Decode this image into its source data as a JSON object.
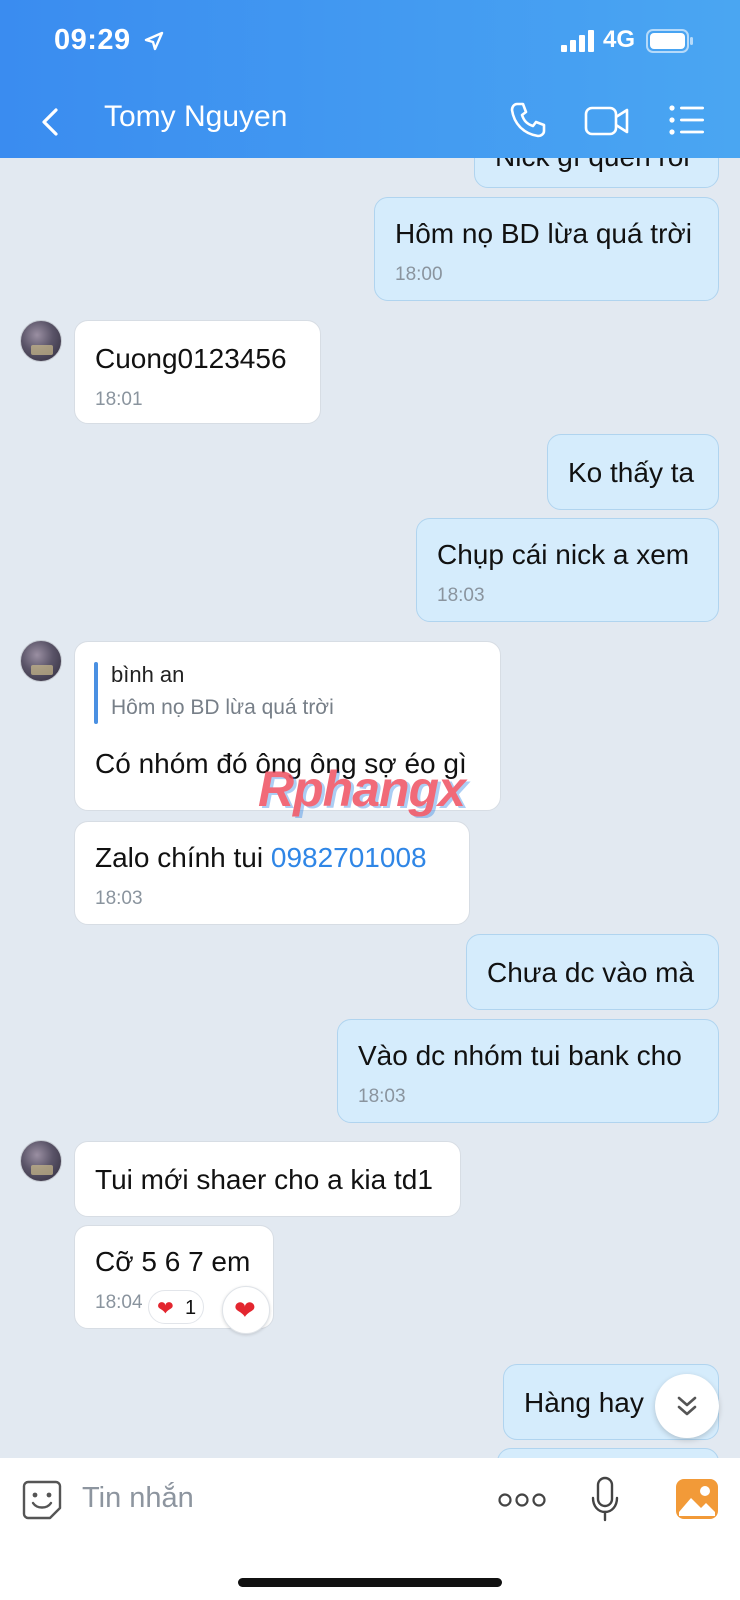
{
  "status_bar": {
    "time": "09:29",
    "network": "4G"
  },
  "header": {
    "title": "Tomy Nguyen"
  },
  "messages": [
    {
      "text": "Nick gì quên rồi"
    },
    {
      "text": "Hôm nọ BD lừa quá trời",
      "time": "18:00"
    },
    {
      "text": "Cuong0123456",
      "time": "18:01"
    },
    {
      "text": "Ko thấy ta"
    },
    {
      "text": "Chụp cái nick a xem",
      "time": "18:03"
    },
    {
      "quote_name": "bình an",
      "quote_text": "Hôm nọ BD lừa quá trời",
      "text": "Có nhóm đó ông ông sợ éo gì"
    },
    {
      "text": "Zalo chính tui ",
      "phone": "0982701008",
      "time": "18:03"
    },
    {
      "text": "Chưa dc vào mà"
    },
    {
      "text": "Vào dc nhóm tui bank cho",
      "time": "18:03"
    },
    {
      "text": "Tui mới shaer cho a kia td1"
    },
    {
      "text": "Cỡ 5 6 7 em",
      "time": "18:04",
      "reaction_count": "1"
    },
    {
      "text": "Hàng hay"
    }
  ],
  "watermark": "Rphangx",
  "input": {
    "placeholder": "Tin nhắn"
  },
  "colors": {
    "header": "#3a8cf0",
    "outgoing_bubble": "#d5ecfc",
    "incoming_bubble": "#ffffff",
    "link": "#2f86e6"
  }
}
